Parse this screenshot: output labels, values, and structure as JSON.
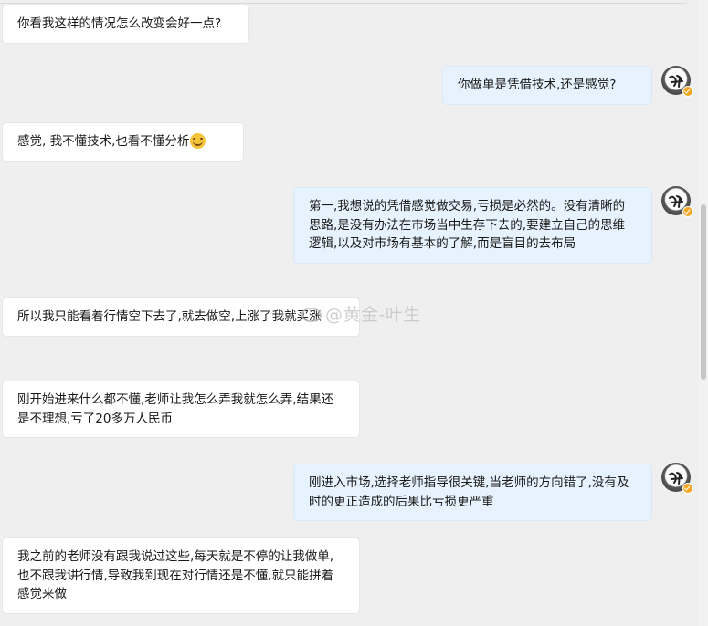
{
  "messages": [
    {
      "side": "in",
      "text": "你看我这样的情况怎么改变会好一点?"
    },
    {
      "side": "out",
      "text": "你做单是凭借技术,还是感觉?"
    },
    {
      "side": "in",
      "text": "感觉, 我不懂技术,也看不懂分析",
      "emoji": "grin-sweat-emoji"
    },
    {
      "side": "out",
      "text": "第一,我想说的凭借感觉做交易,亏损是必然的。没有清晰的思路,是没有办法在市场当中生存下去的,要建立自己的思维逻辑,以及对市场有基本的了解,而是盲目的去布局"
    },
    {
      "side": "in",
      "text": "所以我只能看着行情空下去了,就去做空,上涨了我就买涨"
    },
    {
      "side": "in",
      "text": "刚开始进来什么都不懂,老师让我怎么弄我就怎么弄,结果还是不理想,亏了20多万人民币"
    },
    {
      "side": "out",
      "text": "刚进入市场,选择老师指导很关键,当老师的方向错了,没有及时的更正造成的后果比亏损更严重"
    },
    {
      "side": "in",
      "text": "我之前的老师没有跟我说过这些,每天就是不停的让我做单,也不跟我讲行情,导致我到现在对行情还是不懂,就只能拼着感觉来做"
    }
  ],
  "watermark": "@黄金-叶生",
  "icons": {
    "avatar": "ink-calligraphy-avatar",
    "verified": "verified-badge-icon",
    "watermark_logo": "weibo-logo-icon"
  },
  "colors": {
    "background": "#efefef",
    "incoming_bubble": "#ffffff",
    "outgoing_bubble": "#e6f2fd",
    "verified_badge": "#f5a623"
  }
}
